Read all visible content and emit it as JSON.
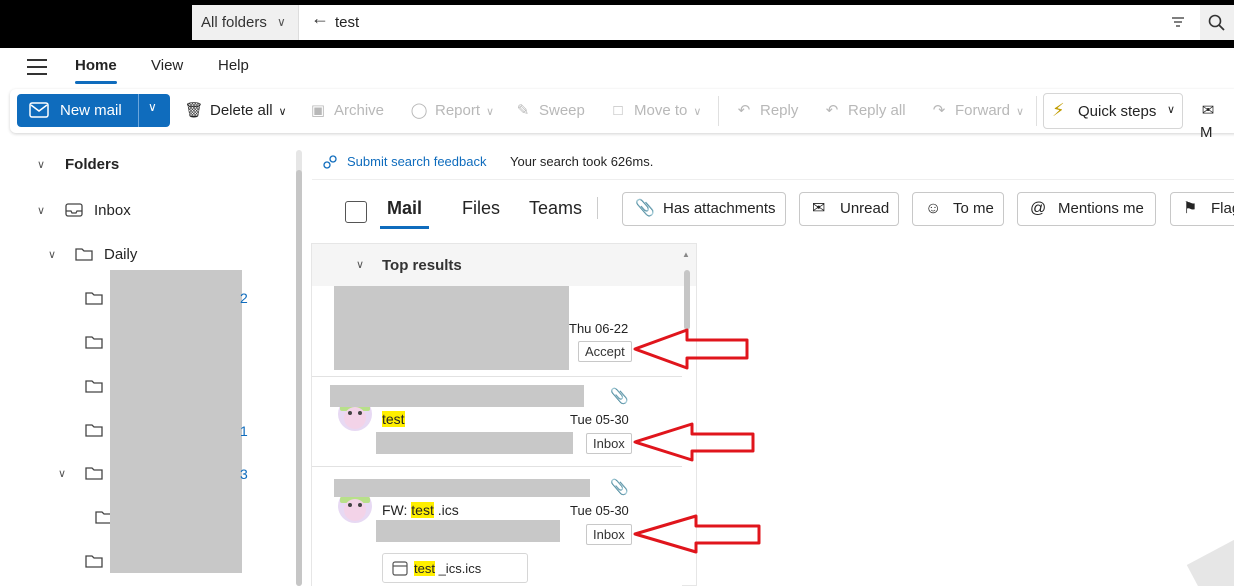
{
  "search": {
    "scope_label": "All folders",
    "query": "test"
  },
  "ribbon_tabs": [
    {
      "label": "Home",
      "active": true
    },
    {
      "label": "View",
      "active": false
    },
    {
      "label": "Help",
      "active": false
    }
  ],
  "toolbar": {
    "new_mail": "New mail",
    "delete_all": "Delete all",
    "archive": "Archive",
    "report": "Report",
    "sweep": "Sweep",
    "move_to": "Move to",
    "reply": "Reply",
    "reply_all": "Reply all",
    "forward": "Forward",
    "quick_steps": "Quick steps",
    "more_partial": "M"
  },
  "nav": {
    "folders_label": "Folders",
    "inbox_label": "Inbox",
    "daily_label": "Daily",
    "partial_counts": [
      "2",
      "1",
      "3"
    ]
  },
  "results_header": {
    "feedback_link": "Submit search feedback",
    "timing": "Your search took 626ms."
  },
  "result_tabs": [
    {
      "label": "Mail",
      "active": true
    },
    {
      "label": "Files",
      "active": false
    },
    {
      "label": "Teams",
      "active": false
    }
  ],
  "filters": {
    "has_attachments": "Has attachments",
    "unread": "Unread",
    "to_me": "To me",
    "mentions_me": "Mentions me",
    "flag_partial": "Flag"
  },
  "list": {
    "section_title": "Top results",
    "messages": [
      {
        "date": "Thu 06-22",
        "tag": "Accept"
      },
      {
        "subject_highlight": "test",
        "date": "Tue 05-30",
        "tag": "Inbox",
        "has_attachment": true
      },
      {
        "subject_prefix": "FW: ",
        "subject_highlight": "test",
        "subject_suffix": " .ics",
        "date": "Tue 05-30",
        "tag": "Inbox",
        "has_attachment": true,
        "attachment_highlight": "test",
        "attachment_suffix": " _ics.ics"
      }
    ]
  },
  "colors": {
    "accent": "#0f6cbd",
    "highlight": "#ffef00",
    "callout": "#e0151c"
  }
}
